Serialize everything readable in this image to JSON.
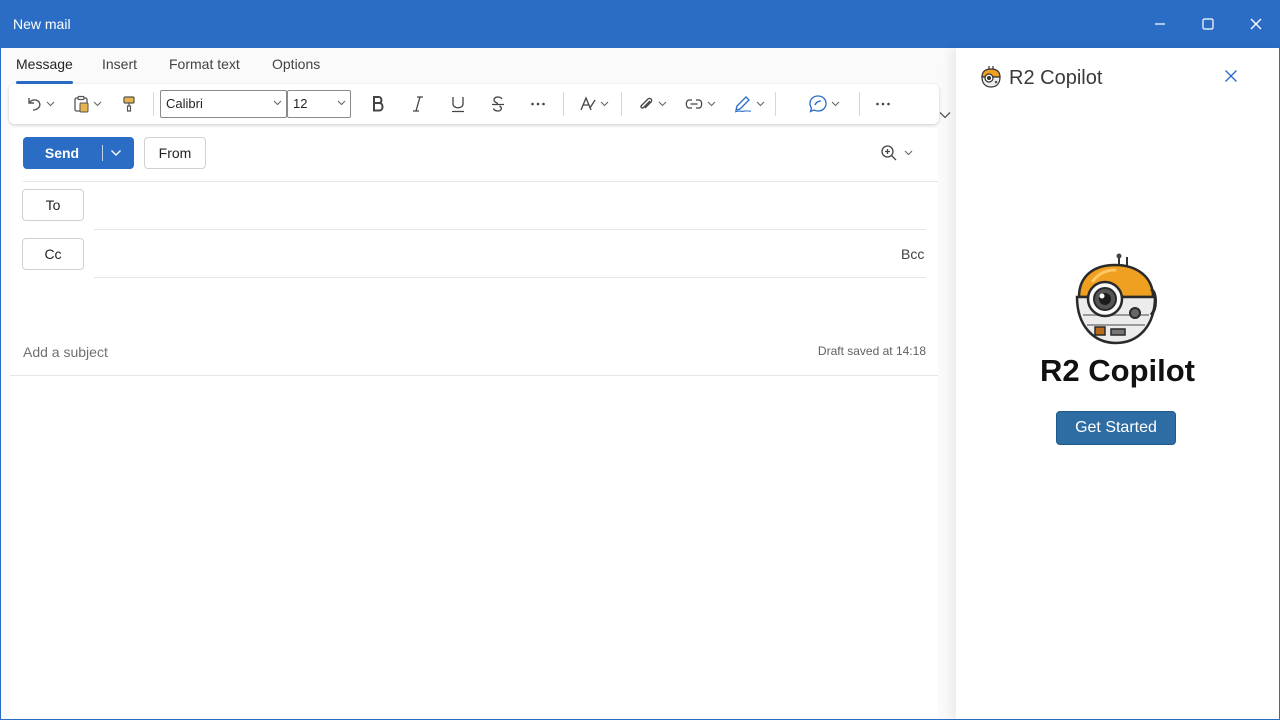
{
  "window": {
    "title": "New mail",
    "controls": [
      "minimize-icon",
      "maximize-icon",
      "close-icon"
    ]
  },
  "tabs": [
    {
      "label": "Message",
      "active": true
    },
    {
      "label": "Insert",
      "active": false
    },
    {
      "label": "Format text",
      "active": false
    },
    {
      "label": "Options",
      "active": false
    }
  ],
  "ribbon": {
    "font_name": "Calibri",
    "font_size": "12",
    "icons": [
      "undo-icon",
      "paste-icon",
      "format-painter-icon",
      "bold-icon",
      "italic-icon",
      "underline-icon",
      "strikethrough-icon",
      "more-icon",
      "styles-icon",
      "attach-icon",
      "link-icon",
      "signature-icon",
      "copilot-icon",
      "more-options-icon"
    ]
  },
  "compose": {
    "send_label": "Send",
    "from_label": "From",
    "to_label": "To",
    "cc_label": "Cc",
    "bcc_label": "Bcc",
    "subject_placeholder": "Add a subject",
    "draft_status": "Draft saved at 14:18"
  },
  "copilot_pane": {
    "header_title": "R2 Copilot",
    "brand_name": "R2 Copilot",
    "cta_label": "Get Started"
  },
  "colors": {
    "accent": "#2b6cc4",
    "cta": "#2e6da3",
    "robot_orange": "#f0a020"
  }
}
